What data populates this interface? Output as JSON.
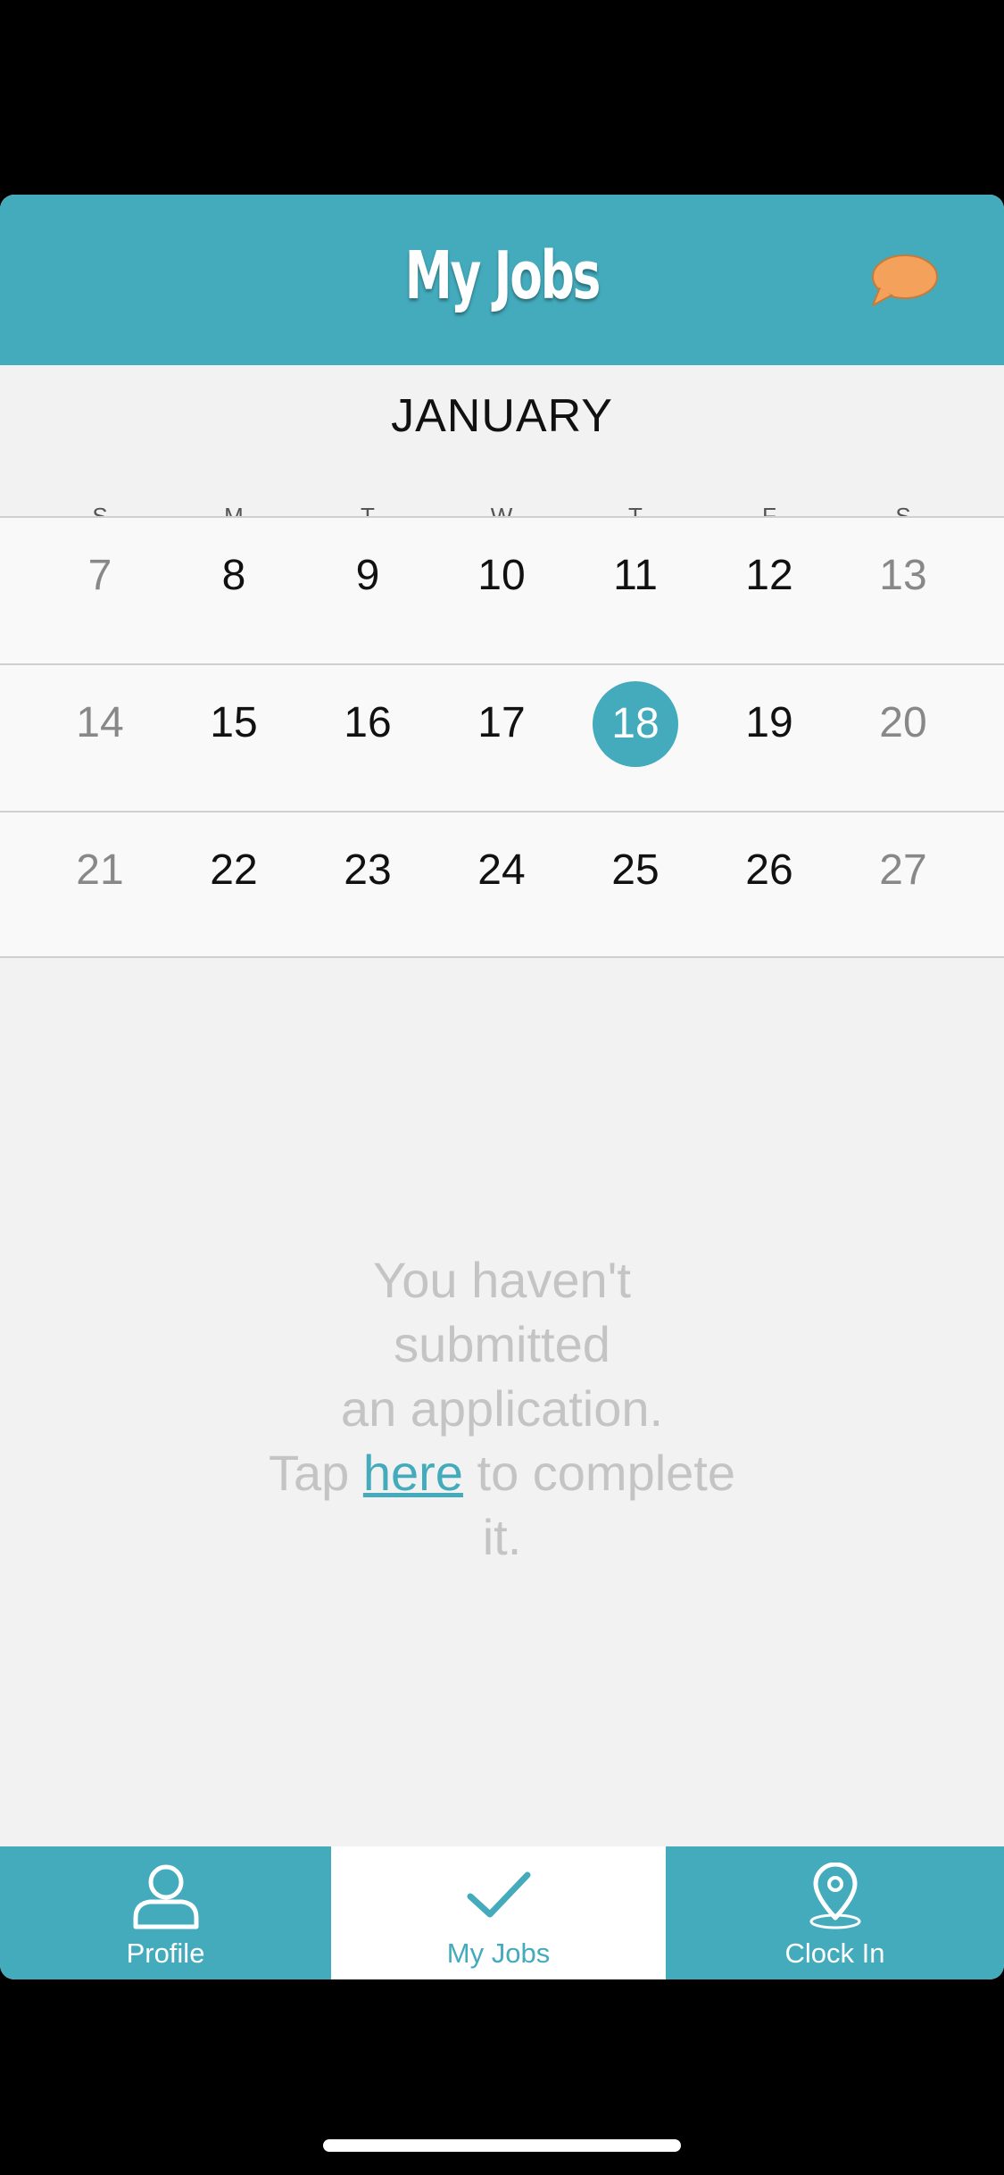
{
  "header": {
    "title": "My Jobs",
    "chat_icon": "speech-bubble-icon",
    "chat_color": "#f4a15c"
  },
  "calendar": {
    "month": "JANUARY",
    "weekdays": [
      "S",
      "M",
      "T",
      "W",
      "T",
      "F",
      "S"
    ],
    "weeks": [
      [
        "7",
        "8",
        "9",
        "10",
        "11",
        "12",
        "13"
      ],
      [
        "14",
        "15",
        "16",
        "17",
        "18",
        "19",
        "20"
      ],
      [
        "21",
        "22",
        "23",
        "24",
        "25",
        "26",
        "27"
      ]
    ],
    "selected_day": "18"
  },
  "empty_state": {
    "line1": "You haven't",
    "line2": "submitted",
    "line3": "an application.",
    "line4_prefix": "Tap ",
    "link": "here",
    "line4_suffix": " to complete",
    "line5": "it."
  },
  "tabs": [
    {
      "label": "Profile",
      "icon": "person-icon"
    },
    {
      "label": "My Jobs",
      "icon": "checkmark-icon"
    },
    {
      "label": "Clock In",
      "icon": "location-pin-icon"
    }
  ],
  "colors": {
    "accent": "#43abbc",
    "background": "#f2f2f2"
  }
}
